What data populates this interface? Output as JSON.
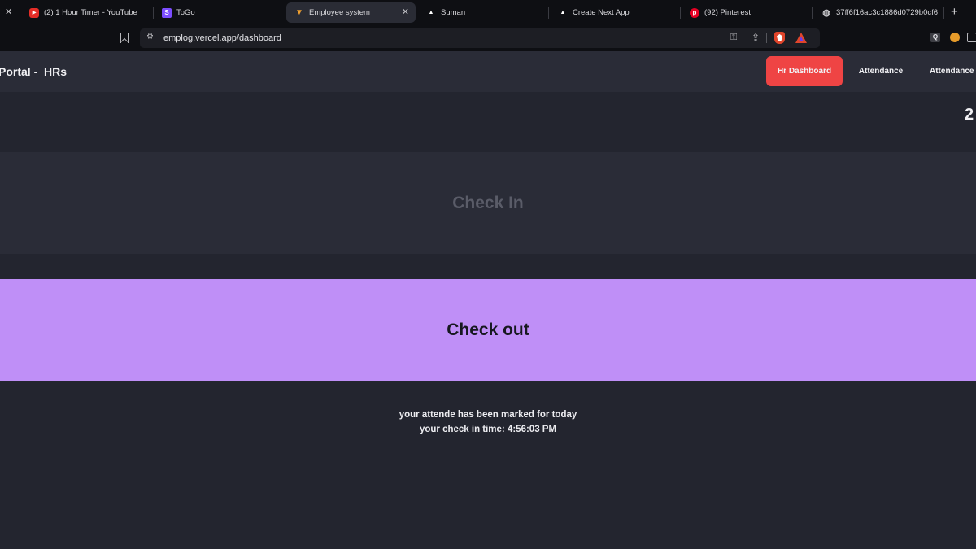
{
  "browser": {
    "tabs": [
      {
        "title": "(2) 1 Hour Timer - YouTube",
        "icon": "youtube-icon",
        "color": "#e52d27"
      },
      {
        "title": "ToGo",
        "icon": "togo-icon",
        "color": "#7c4dff"
      },
      {
        "title": "Employee system",
        "icon": "employee-system-icon",
        "color": "#f0a030",
        "active": true
      },
      {
        "title": "Suman",
        "icon": "vercel-icon",
        "color": "#ffffff"
      },
      {
        "title": "Create Next App",
        "icon": "vercel-icon",
        "color": "#ffffff"
      },
      {
        "title": "(92) Pinterest",
        "icon": "pinterest-icon",
        "color": "#e60023"
      },
      {
        "title": "37ff6f16ac3c1886d0729b0cf6",
        "icon": "globe-icon",
        "color": "#c8c8cc"
      }
    ],
    "url": "emplog.vercel.app/dashboard",
    "togo_letter": "S",
    "extension_q_letter": "Q"
  },
  "app": {
    "brand": "Portal -  HRs",
    "nav": [
      "Hr Dashboard",
      "Attendance",
      "Attendance"
    ],
    "corner_number": "2",
    "check_in_label": "Check In",
    "check_out_label": "Check out",
    "message_line1": "your attende has been marked for today",
    "message_line2": "your check in time: 4:56:03 PM",
    "colors": {
      "accent_red": "#ef4444",
      "check_out_bg": "#bf8ff7",
      "background": "#23252f"
    }
  }
}
